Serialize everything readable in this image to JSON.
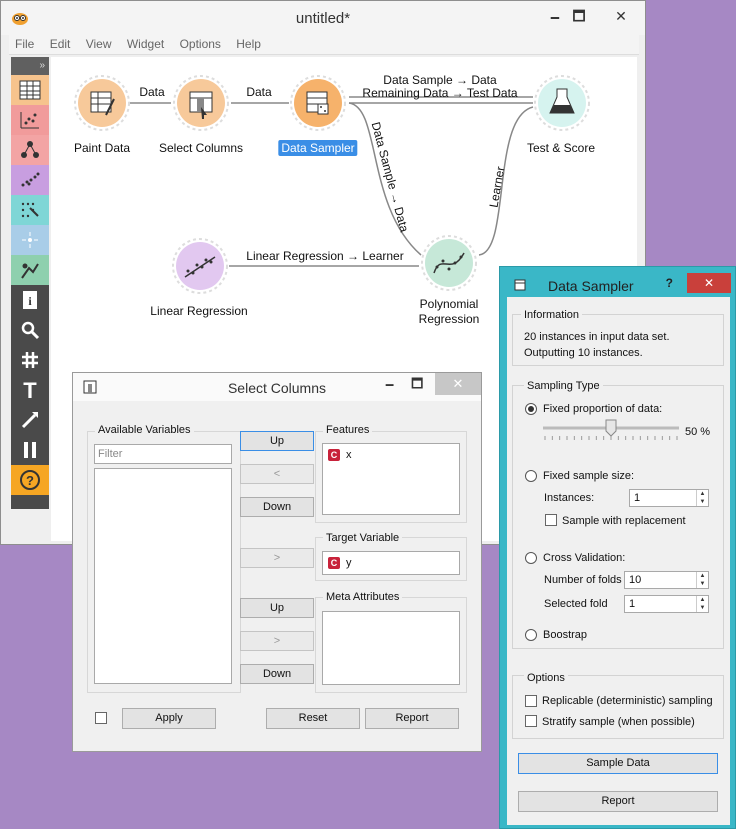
{
  "main": {
    "title": "untitled*",
    "menu": [
      "File",
      "Edit",
      "View",
      "Widget",
      "Options",
      "Help"
    ],
    "min": "🗕",
    "max": "🗖",
    "close": "✕"
  },
  "toolbox": {
    "collapse": "»"
  },
  "canvas": {
    "nodes": {
      "paint": "Paint Data",
      "select": "Select Columns",
      "sampler": "Data Sampler",
      "test": "Test & Score",
      "linreg": "Linear Regression",
      "poly1": "Polynomial",
      "poly2": "Regression"
    },
    "links": {
      "l1": "Data",
      "l2": "Data",
      "l3a": "Data Sample → Data",
      "l3b": "Remaining Data → Test Data",
      "l4": "Data Sample → Data",
      "l5": "Learner",
      "l6": "Linear Regression → Learner"
    }
  },
  "select_columns": {
    "title": "Select Columns",
    "available_label": "Available Variables",
    "filter_placeholder": "Filter",
    "features_label": "Features",
    "features": [
      {
        "type": "C",
        "name": "x"
      }
    ],
    "target_label": "Target Variable",
    "target": [
      {
        "type": "C",
        "name": "y"
      }
    ],
    "meta_label": "Meta Attributes",
    "up": "Up",
    "left": "<",
    "down": "Down",
    "right": ">",
    "up2": "Up",
    "right2": ">",
    "down2": "Down",
    "apply": "Apply",
    "reset": "Reset",
    "report": "Report",
    "close": "✕",
    "min": "🗕",
    "max": "🗖"
  },
  "data_sampler": {
    "title": "Data Sampler",
    "help": "?",
    "close": "✕",
    "info_label": "Information",
    "info1": "20 instances in input data set.",
    "info2": "Outputting 10 instances.",
    "sampling_label": "Sampling Type",
    "fixed_prop": "Fixed proportion of data:",
    "prop_value": "50 %",
    "prop_fraction": 0.5,
    "fixed_size": "Fixed sample size:",
    "instances_label": "Instances:",
    "instances_value": "1",
    "with_replacement": "Sample with replacement",
    "cross_val": "Cross Validation:",
    "folds_label": "Number of folds",
    "folds_value": "10",
    "selected_fold_label": "Selected fold",
    "selected_fold_value": "1",
    "boostrap": "Boostrap",
    "options_label": "Options",
    "replicable": "Replicable (deterministic) sampling",
    "stratify": "Stratify sample (when possible)",
    "sample_btn": "Sample Data",
    "report_btn": "Report"
  }
}
